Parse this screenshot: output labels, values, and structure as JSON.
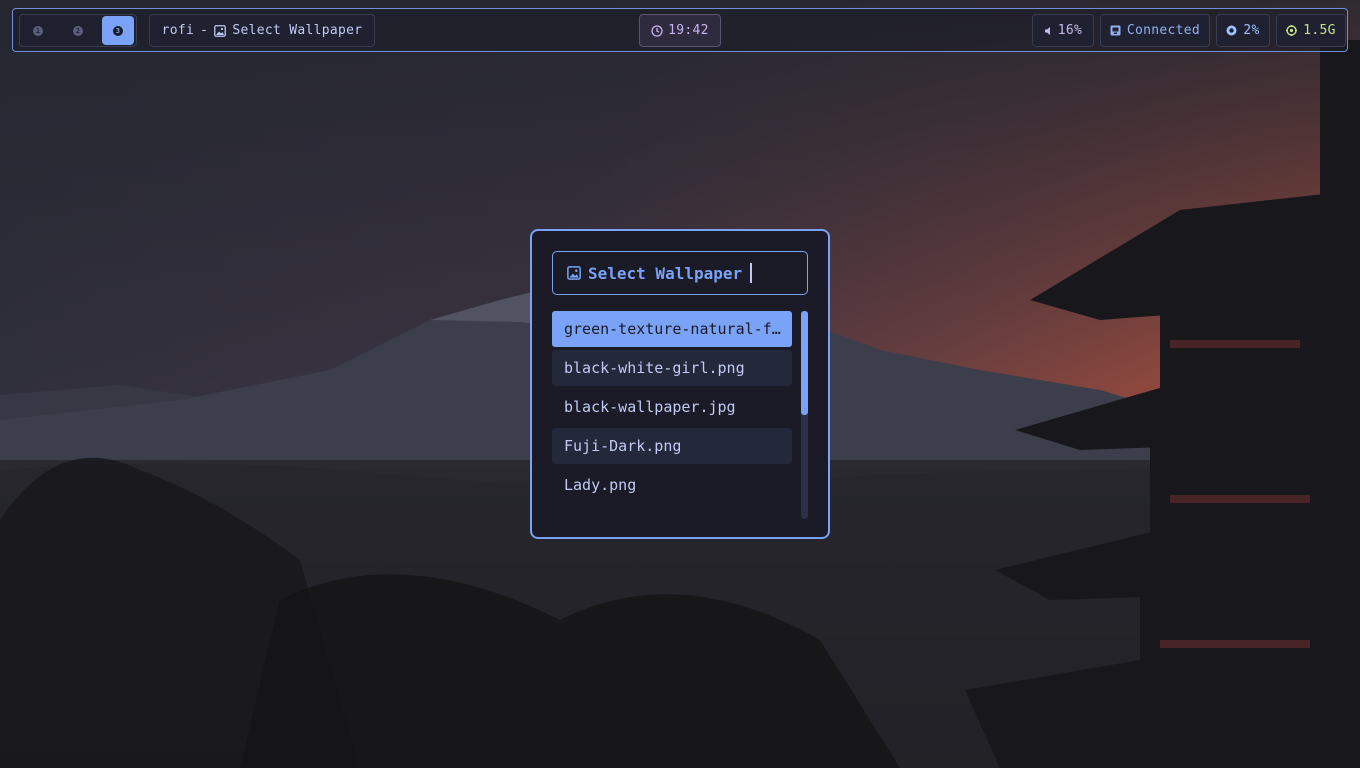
{
  "topbar": {
    "workspaces": [
      {
        "label": "1",
        "active": false
      },
      {
        "label": "2",
        "active": false
      },
      {
        "label": "3",
        "active": true
      }
    ],
    "window_title": {
      "app": "rofi",
      "separator": "-",
      "icon": "image-icon",
      "text": "Select Wallpaper"
    },
    "clock": {
      "icon": "clock-icon",
      "time": "19:42"
    },
    "volume": {
      "icon": "speaker-icon",
      "value": "16%"
    },
    "network": {
      "icon": "network-icon",
      "status": "Connected"
    },
    "cpu": {
      "icon": "cpu-icon",
      "value": "2%"
    },
    "memory": {
      "icon": "memory-icon",
      "value": "1.5G"
    }
  },
  "rofi": {
    "prompt": {
      "icon": "image-icon",
      "text": "Select Wallpaper"
    },
    "entries": [
      {
        "label": "green-texture-natural-f…",
        "selected": true
      },
      {
        "label": "black-white-girl.png",
        "selected": false
      },
      {
        "label": "black-wallpaper.jpg",
        "selected": false
      },
      {
        "label": "Fuji-Dark.png",
        "selected": false
      },
      {
        "label": "Lady.png",
        "selected": false
      }
    ],
    "scroll_fraction_visible": 0.5
  },
  "colors": {
    "accent": "#7aa2f7",
    "background": "#1a1b26",
    "foreground": "#c0caf5",
    "memory": "#c5e08a",
    "clock": "#c9b3f0"
  }
}
